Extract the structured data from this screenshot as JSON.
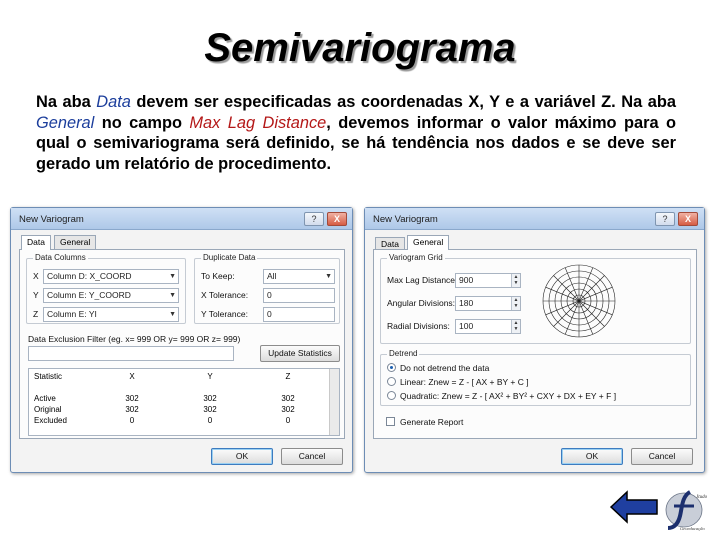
{
  "slide": {
    "title": "Semivariograma",
    "para": {
      "s1": "Na aba ",
      "data_tab": "Data",
      "s2": " devem ser especificadas as coordenadas X, Y e a variável Z. Na aba ",
      "general_tab": "General",
      "s3": " no campo ",
      "max_lag": "Max Lag Distance",
      "s4": ", devemos informar o valor máximo para  o qual o semivariograma será definido, se há tendência nos dados e se deve ser gerado um relatório de procedimento."
    }
  },
  "dialog_left": {
    "title": "New Variogram",
    "help": "?",
    "close": "X",
    "tabs": [
      "Data",
      "General"
    ],
    "data_columns_label": "Data Columns",
    "x_label": "X",
    "y_label": "Y",
    "z_label": "Z",
    "x_value": "Column D: X_COORD",
    "y_value": "Column E: Y_COORD",
    "z_value": "Column E: YI",
    "duplicate_label": "Duplicate Data",
    "to_keep_label": "To Keep:",
    "to_keep_value": "All",
    "x_tol_label": "X Tolerance:",
    "x_tol_value": "0",
    "y_tol_label": "Y Tolerance:",
    "y_tol_value": "0",
    "exclusion_label": "Data Exclusion Filter (eg. x= 999 OR y= 999 OR z= 999)",
    "update_button": "Update Statistics",
    "table_header": [
      "Statistic",
      "X",
      "Y",
      "Z"
    ],
    "table_rows": [
      [
        "Active",
        "302",
        "302",
        "302"
      ],
      [
        "Original",
        "302",
        "302",
        "302"
      ],
      [
        "Excluded",
        "0",
        "0",
        "0"
      ]
    ],
    "ok": "OK",
    "cancel": "Cancel"
  },
  "dialog_right": {
    "title": "New Variogram",
    "help": "?",
    "close": "X",
    "tabs": [
      "Data",
      "General"
    ],
    "grid_label": "Variogram Grid",
    "max_lag_label": "Max Lag Distance:",
    "max_lag_value": "900",
    "angular_label": "Angular Divisions:",
    "angular_value": "180",
    "radial_label": "Radial Divisions:",
    "radial_value": "100",
    "detrend_label": "Detrend",
    "opt1": "Do not detrend the data",
    "opt2": "Linear:  Znew  =  Z - [ AX + BY + C ]",
    "opt3": "Quadratic:  Znew  =  Z - [ AX² + BY² + CXY + DX + EY + F ]",
    "generate_report": "Generate Report",
    "ok": "OK",
    "cancel": "Cancel"
  },
  "nav": {
    "back_arrow_color": "#1f3fa0",
    "logo_icon": "stylized-f-logo",
    "logo_text": "Jtudo / Geoeducação"
  }
}
